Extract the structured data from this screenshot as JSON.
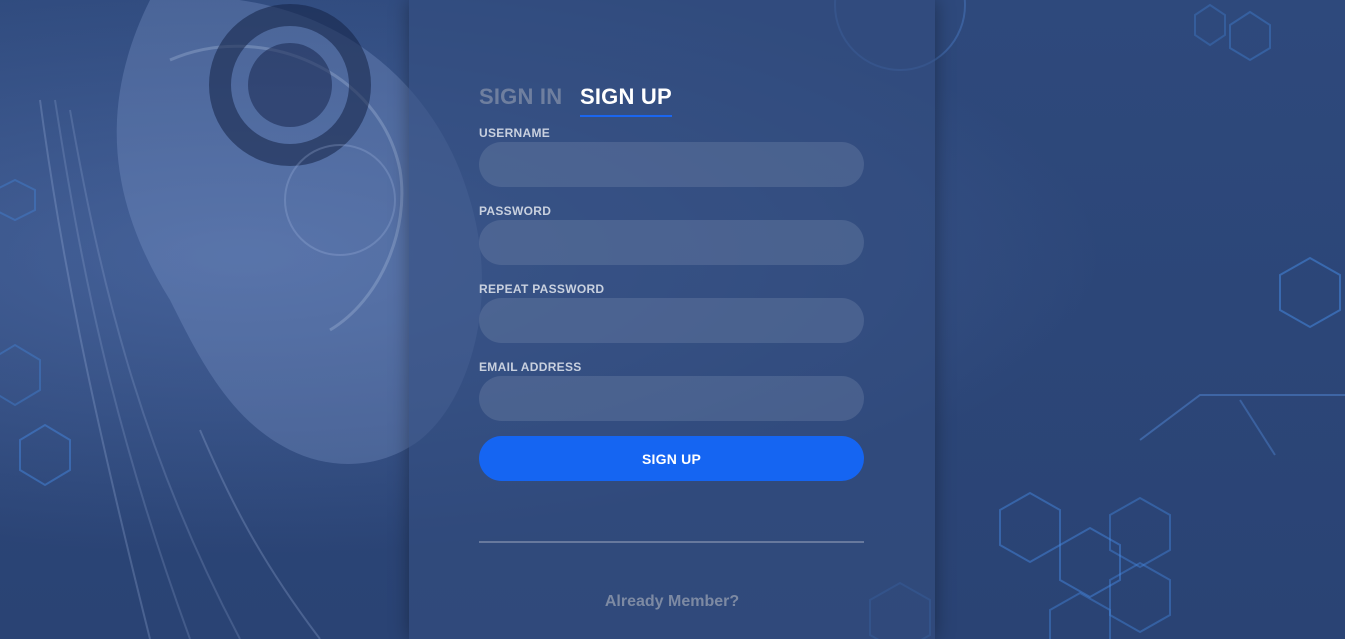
{
  "tabs": {
    "sign_in": "SIGN IN",
    "sign_up": "SIGN UP"
  },
  "form": {
    "username_label": "USERNAME",
    "username_value": "",
    "password_label": "PASSWORD",
    "password_value": "",
    "repeat_password_label": "REPEAT PASSWORD",
    "repeat_password_value": "",
    "email_label": "EMAIL ADDRESS",
    "email_value": "",
    "submit_label": "SIGN UP"
  },
  "footer": {
    "already_member": "Already Member?"
  },
  "colors": {
    "accent": "#1565f2",
    "background": "#2c4577",
    "active_tab": "#ffffff",
    "inactive_tab": "#6f7f9f"
  },
  "background_image": "robot-head-circuit-hexagon-illustration"
}
